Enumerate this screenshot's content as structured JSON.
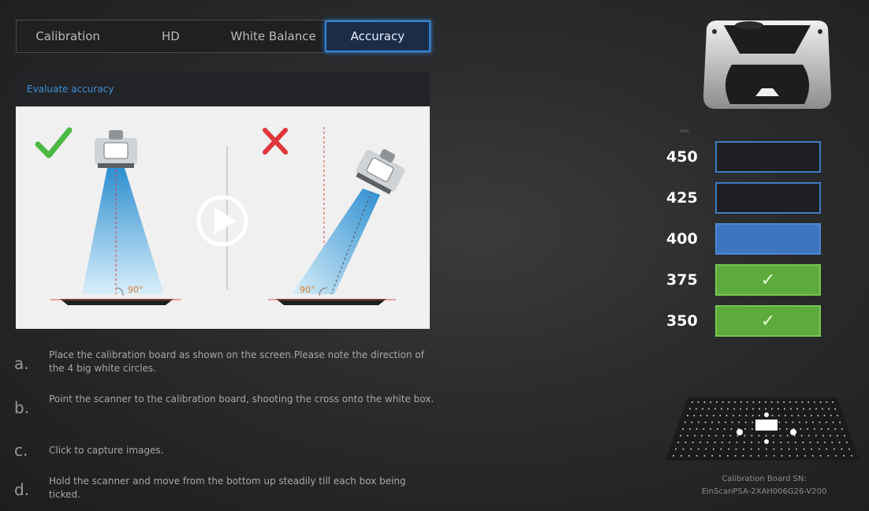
{
  "tabs": [
    {
      "label": "Calibration",
      "active": false
    },
    {
      "label": "HD",
      "active": false
    },
    {
      "label": "White Balance",
      "active": false
    },
    {
      "label": "Accuracy",
      "active": true
    }
  ],
  "panel": {
    "title": "Evaluate accuracy"
  },
  "illustration": {
    "left_angle": "90°",
    "right_angle": "90°",
    "left_icon": "check-icon",
    "right_icon": "cross-icon",
    "center_icon": "play-icon"
  },
  "steps": [
    {
      "letter": "a.",
      "text": "Place the calibration board as shown on the screen.Please note the direction of the 4 big white circles."
    },
    {
      "letter": "b.",
      "text": "Point the scanner to the calibration board, shooting the cross onto the white box."
    },
    {
      "letter": "c.",
      "text": "Click to capture images."
    },
    {
      "letter": "d.",
      "text": "Hold the scanner and move from the bottom up steadily till each box being ticked."
    }
  ],
  "gauge": {
    "unit": "mm",
    "rows": [
      {
        "value": "450",
        "state": "empty",
        "mark": ""
      },
      {
        "value": "425",
        "state": "empty",
        "mark": ""
      },
      {
        "value": "400",
        "state": "current",
        "mark": ""
      },
      {
        "value": "375",
        "state": "done",
        "mark": "✓"
      },
      {
        "value": "350",
        "state": "done",
        "mark": "✓"
      }
    ]
  },
  "board": {
    "label_line1": "Calibration Board SN:",
    "label_line2": "EinScanPSA-2XAH006G26-V200"
  },
  "colors": {
    "accent": "#2f83d4",
    "done": "#5dab3c",
    "current": "#3d76bf"
  }
}
